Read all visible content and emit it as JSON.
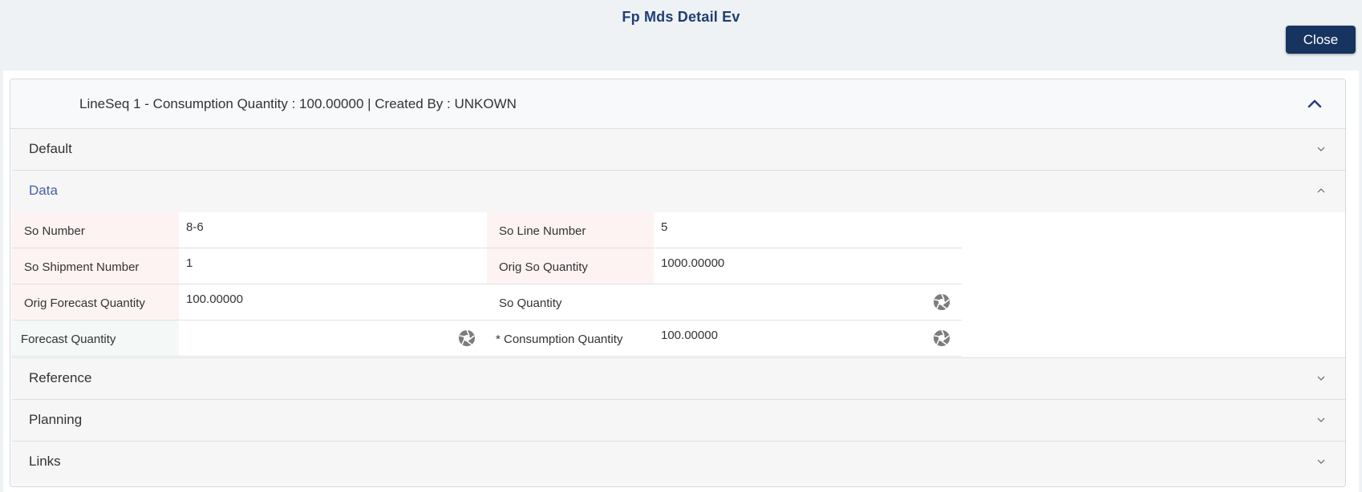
{
  "header": {
    "title": "Fp Mds Detail Ev",
    "close_label": "Close"
  },
  "card": {
    "summary": "LineSeq 1 - Consumption Quantity  : 100.00000 | Created By  : UNKOWN"
  },
  "sections": {
    "default": "Default",
    "data": "Data",
    "reference": "Reference",
    "planning": "Planning",
    "links": "Links"
  },
  "fields": {
    "so_number": {
      "label": "So Number",
      "value": "8-6"
    },
    "so_line_number": {
      "label": "So Line Number",
      "value": "5"
    },
    "so_shipment_number": {
      "label": "So Shipment Number",
      "value": "1"
    },
    "orig_so_quantity": {
      "label": "Orig So Quantity",
      "value": "1000.00000"
    },
    "orig_forecast_quantity": {
      "label": "Orig Forecast Quantity",
      "value": "100.00000"
    },
    "so_quantity": {
      "label": "So Quantity",
      "value": ""
    },
    "forecast_quantity": {
      "label": "Forecast Quantity",
      "value": ""
    },
    "consumption_quantity": {
      "label": "* Consumption Quantity",
      "value": "100.00000"
    }
  },
  "icons": {
    "collapse": "chevron-up-icon",
    "expand": "chevron-down-icon",
    "lookup": "aperture-icon"
  },
  "colors": {
    "title": "#1f3f73",
    "close_button": "#17335f",
    "active_section": "#4a5fa6"
  }
}
